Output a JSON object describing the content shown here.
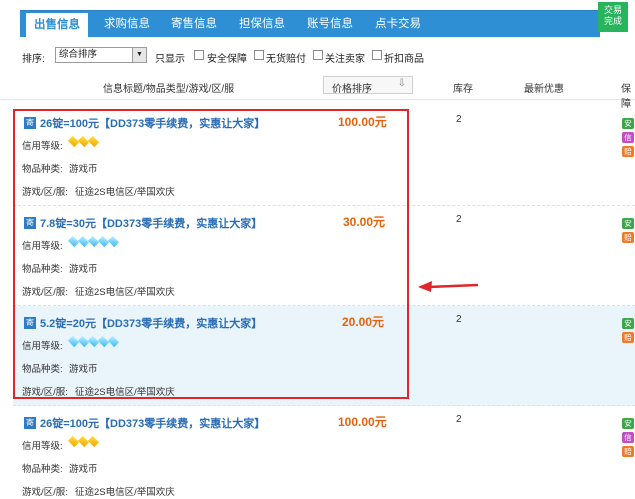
{
  "tabs": [
    {
      "label": "出售信息",
      "active": true
    },
    {
      "label": "求购信息",
      "active": false
    },
    {
      "label": "寄售信息",
      "active": false
    },
    {
      "label": "担保信息",
      "active": false
    },
    {
      "label": "账号信息",
      "active": false
    },
    {
      "label": "点卡交易",
      "active": false
    }
  ],
  "corner": {
    "line1": "交易",
    "line2": "完成"
  },
  "filter": {
    "sort_label": "排序:",
    "sort_value": "综合排序",
    "options": [
      "只显示",
      "安全保障",
      "无货赔付",
      "关注卖家",
      "折扣商品"
    ]
  },
  "columns": {
    "info": "信息标题/物品类型/游戏/区/服",
    "price_sort": "价格排序",
    "stock": "库存",
    "promo": "最新优惠",
    "guarantee": "保障"
  },
  "field_labels": {
    "credit": "信用等级:",
    "type": "物品种类:",
    "server": "游戏/区/服:"
  },
  "listings": [
    {
      "badge": "寄",
      "title": "26锭=100元【DD373零手续费，实惠让大家】",
      "price": "100.00元",
      "stock": "2",
      "gem_color": "gold",
      "gems": 3,
      "item_type": "游戏币",
      "server": "征途2S电信区/举国欢庆",
      "guarantees": [
        {
          "icon": "安",
          "text": "安",
          "color": "green"
        },
        {
          "icon": "信",
          "text": "诉",
          "color": "purple"
        },
        {
          "icon": "赔",
          "text": "押",
          "color": "orange"
        }
      ]
    },
    {
      "badge": "寄",
      "title": "7.8锭=30元【DD373零手续费，实惠让大家】",
      "price": "30.00元",
      "stock": "2",
      "gem_color": "blue",
      "gems": 5,
      "item_type": "游戏币",
      "server": "征途2S电信区/举国欢庆",
      "guarantees": [
        {
          "icon": "安",
          "text": "安",
          "color": "green"
        },
        {
          "icon": "赔",
          "text": "押",
          "color": "orange"
        }
      ]
    },
    {
      "badge": "寄",
      "title": "5.2锭=20元【DD373零手续费，实惠让大家】",
      "price": "20.00元",
      "stock": "2",
      "gem_color": "blue",
      "gems": 5,
      "item_type": "游戏币",
      "server": "征途2S电信区/举国欢庆",
      "guarantees": [
        {
          "icon": "安",
          "text": "安",
          "color": "green"
        },
        {
          "icon": "赔",
          "text": "押",
          "color": "orange"
        }
      ]
    },
    {
      "badge": "寄",
      "title": "26锭=100元【DD373零手续费，实惠让大家】",
      "price": "100.00元",
      "stock": "2",
      "gem_color": "gold",
      "gems": 3,
      "item_type": "游戏币",
      "server": "征途2S电信区/举国欢庆",
      "guarantees": [
        {
          "icon": "安",
          "text": "安",
          "color": "green"
        },
        {
          "icon": "信",
          "text": "诉",
          "color": "purple"
        },
        {
          "icon": "赔",
          "text": "押",
          "color": "orange"
        }
      ]
    }
  ],
  "colors": {
    "accent": "#2f8fd4",
    "price": "#e8620c",
    "annotation": "#e0262a",
    "highlight_row": "#eaf4fb"
  },
  "annotation": {
    "kind": "red-box-with-arrow",
    "highlighted_rows": [
      0,
      1,
      2
    ]
  }
}
